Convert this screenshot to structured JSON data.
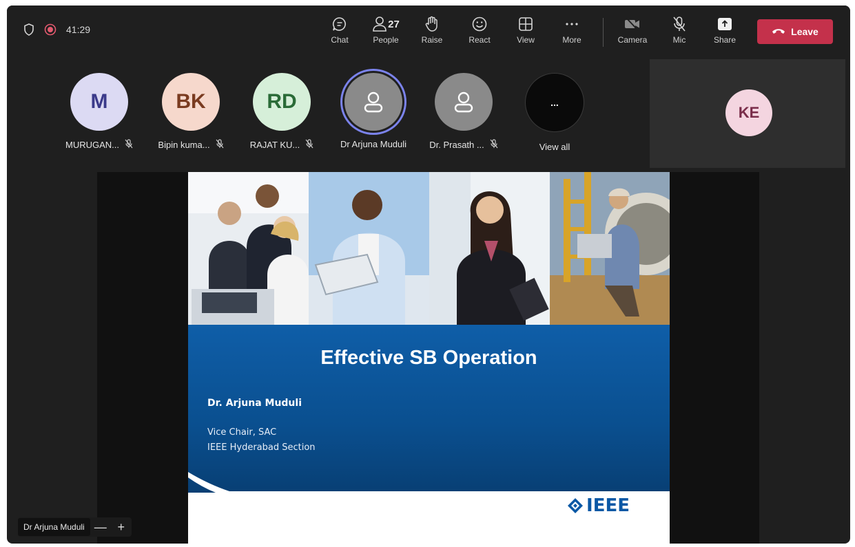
{
  "topbar": {
    "timer": "41:29",
    "tools": [
      {
        "id": "chat",
        "label": "Chat",
        "icon": "chat-icon"
      },
      {
        "id": "people",
        "label": "People",
        "icon": "people-icon",
        "count": "27"
      },
      {
        "id": "raise",
        "label": "Raise",
        "icon": "hand-icon"
      },
      {
        "id": "react",
        "label": "React",
        "icon": "smiley-icon"
      },
      {
        "id": "view",
        "label": "View",
        "icon": "grid-icon"
      },
      {
        "id": "more",
        "label": "More",
        "icon": "ellipsis-icon"
      },
      {
        "id": "camera",
        "label": "Camera",
        "icon": "camera-off-icon"
      },
      {
        "id": "mic",
        "label": "Mic",
        "icon": "mic-off-icon"
      },
      {
        "id": "share",
        "label": "Share",
        "icon": "share-icon"
      }
    ],
    "leave_label": "Leave",
    "accent_red": "#c4314b"
  },
  "participants": [
    {
      "initials": "M",
      "name": "MURUGAN...",
      "muted": true,
      "bg": "#dcdaf3",
      "fg": "#3b3a8a"
    },
    {
      "initials": "BK",
      "name": "Bipin kuma...",
      "muted": true,
      "bg": "#f6d8cc",
      "fg": "#7a3b20"
    },
    {
      "initials": "RD",
      "name": "RAJAT KU...",
      "muted": true,
      "bg": "#d6efd9",
      "fg": "#2a6b37"
    },
    {
      "initials": "",
      "name": "Dr Arjuna Muduli",
      "muted": false,
      "speaking": true
    },
    {
      "initials": "",
      "name": "Dr. Prasath ...",
      "muted": true
    },
    {
      "initials": "...",
      "name": "View all"
    }
  ],
  "side_tile": {
    "initials": "KE"
  },
  "slide": {
    "title": "Effective SB Operation",
    "presenter": "Dr. Arjuna Muduli",
    "role_line1": "Vice Chair, SAC",
    "role_line2": "IEEE Hyderabad Section",
    "logo_text": "IEEE"
  },
  "nametag": {
    "name": "Dr Arjuna Muduli",
    "zoom_out": "—",
    "zoom_in": "+"
  }
}
